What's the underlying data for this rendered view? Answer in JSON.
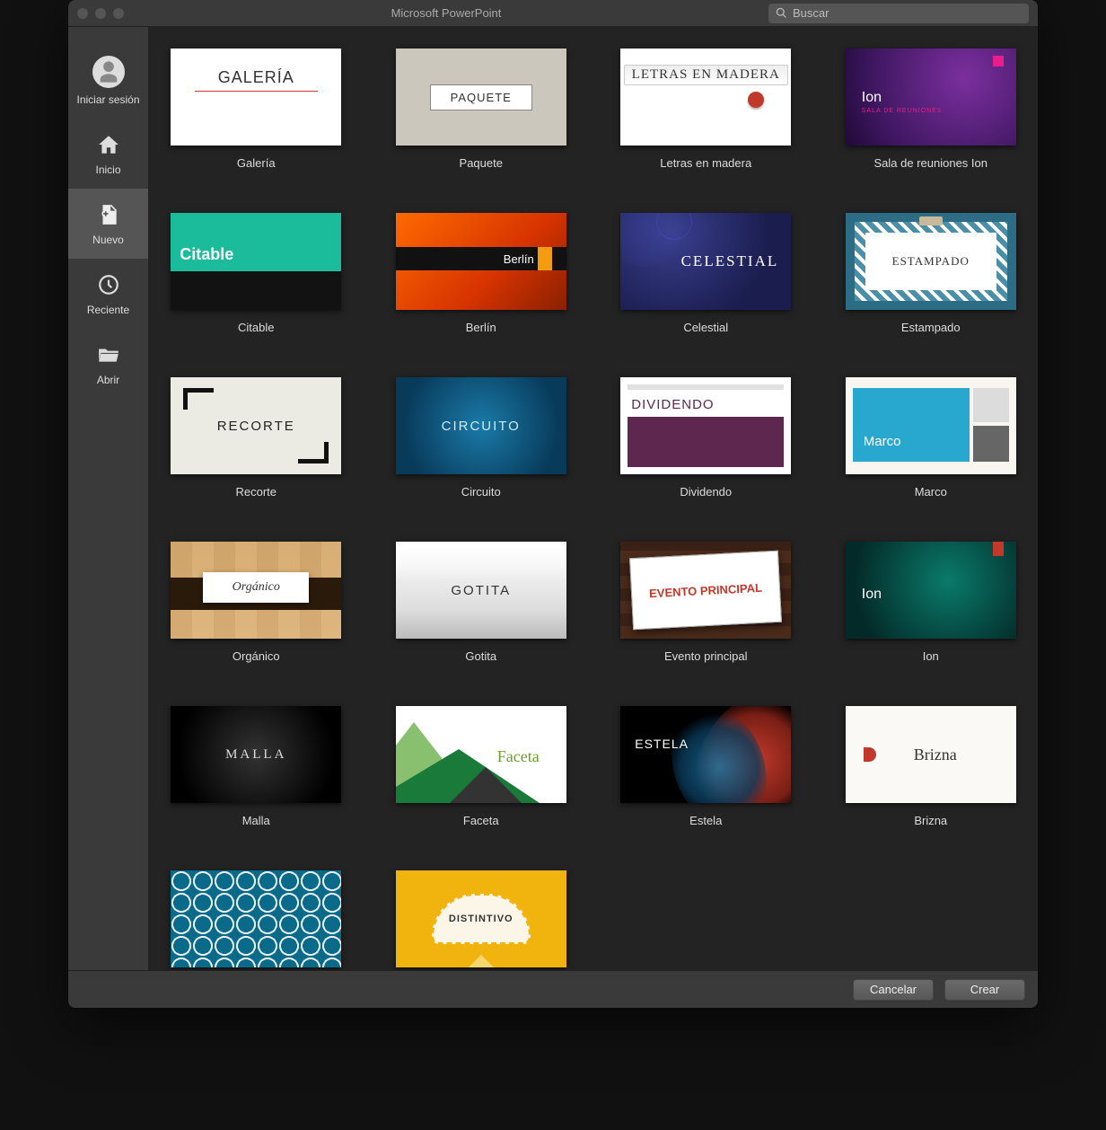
{
  "window": {
    "title": "Microsoft PowerPoint"
  },
  "search": {
    "placeholder": "Buscar"
  },
  "sidebar": {
    "signin": "Iniciar sesión",
    "items": [
      {
        "id": "home",
        "label": "Inicio",
        "icon": "home-icon"
      },
      {
        "id": "new",
        "label": "Nuevo",
        "icon": "new-file-icon",
        "active": true
      },
      {
        "id": "recent",
        "label": "Reciente",
        "icon": "clock-icon"
      },
      {
        "id": "open",
        "label": "Abrir",
        "icon": "folder-open-icon"
      }
    ]
  },
  "templates": [
    {
      "label": "Galería",
      "thumb_text": "GALERÍA"
    },
    {
      "label": "Paquete",
      "thumb_text": "PAQUETE"
    },
    {
      "label": "Letras en madera",
      "thumb_text": "LETRAS EN MADERA"
    },
    {
      "label": "Sala de reuniones Ion",
      "thumb_text": "Ion",
      "thumb_sub": "SALA DE REUNIONES"
    },
    {
      "label": "Citable",
      "thumb_text": "Citable"
    },
    {
      "label": "Berlín",
      "thumb_text": "Berlín"
    },
    {
      "label": "Celestial",
      "thumb_text": "CELESTIAL"
    },
    {
      "label": "Estampado",
      "thumb_text": "ESTAMPADO"
    },
    {
      "label": "Recorte",
      "thumb_text": "RECORTE"
    },
    {
      "label": "Circuito",
      "thumb_text": "CIRCUITO"
    },
    {
      "label": "Dividendo",
      "thumb_text": "DIVIDENDO"
    },
    {
      "label": "Marco",
      "thumb_text": "Marco"
    },
    {
      "label": "Orgánico",
      "thumb_text": "Orgánico"
    },
    {
      "label": "Gotita",
      "thumb_text": "GOTITA"
    },
    {
      "label": "Evento principal",
      "thumb_text": "EVENTO PRINCIPAL"
    },
    {
      "label": "Ion",
      "thumb_text": "Ion"
    },
    {
      "label": "Malla",
      "thumb_text": "MALLA"
    },
    {
      "label": "Faceta",
      "thumb_text": "Faceta"
    },
    {
      "label": "Estela",
      "thumb_text": "ESTELA"
    },
    {
      "label": "Brizna",
      "thumb_text": "Brizna"
    },
    {
      "label": "",
      "thumb_text": ""
    },
    {
      "label": "",
      "thumb_text": "DISTINTIVO"
    }
  ],
  "footer": {
    "cancel": "Cancelar",
    "create": "Crear"
  }
}
